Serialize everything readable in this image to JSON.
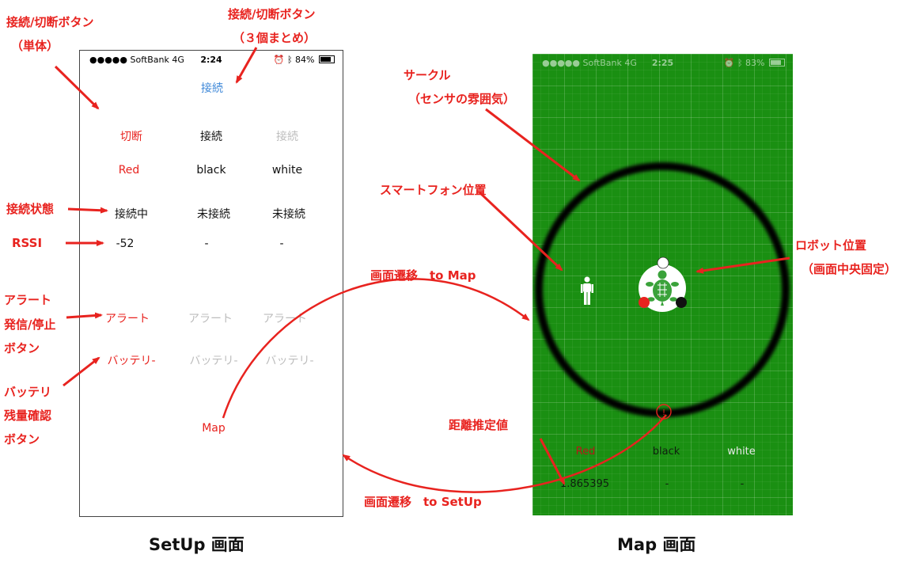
{
  "annotations": {
    "connect_single": "接続/切断ボタン",
    "connect_single_sub": "（単体）",
    "connect_group": "接続/切断ボタン",
    "connect_group_sub": "（３個まとめ）",
    "conn_state": "接続状態",
    "rssi": "RSSI",
    "alert_1": "アラート",
    "alert_2": "発信/停止",
    "alert_3": "ボタン",
    "battery_1": "バッテリ",
    "battery_2": "残量確認",
    "battery_3": "ボタン",
    "circle_1": "サークル",
    "circle_2": "（センサの雰囲気）",
    "phone_pos": "スマートフォン位置",
    "robot_pos_1": "ロボット位置",
    "robot_pos_2": "（画面中央固定）",
    "to_map": "画面遷移　to Map",
    "distance": "距離推定値",
    "to_setup": "画面遷移　to SetUp",
    "caption_setup": "SetUp 画面",
    "caption_map": "Map 画面"
  },
  "setup": {
    "status": {
      "carrier": "●●●●● SoftBank  4G",
      "time": "2:24",
      "battery": "84%"
    },
    "connect_all": "接続",
    "row_buttons": [
      "切断",
      "接続",
      "接続"
    ],
    "names": [
      "Red",
      "black",
      "white"
    ],
    "states": [
      "接続中",
      "未接続",
      "未接続"
    ],
    "rssi": [
      "-52",
      "-",
      "-"
    ],
    "alert": [
      "アラート",
      "アラート",
      "アラート"
    ],
    "battery": [
      "バッテリ-",
      "バッテリ-",
      "バッテリ-"
    ],
    "map_button": "Map"
  },
  "map": {
    "status": {
      "carrier": "●●●●● SoftBank  4G",
      "time": "2:25",
      "battery": "83%"
    },
    "names": [
      "Red",
      "black",
      "white"
    ],
    "distances": [
      "1.865395",
      "-",
      "-"
    ],
    "colors": {
      "background": "#1a8f12",
      "red": "#e8231f",
      "black": "#111111"
    }
  }
}
